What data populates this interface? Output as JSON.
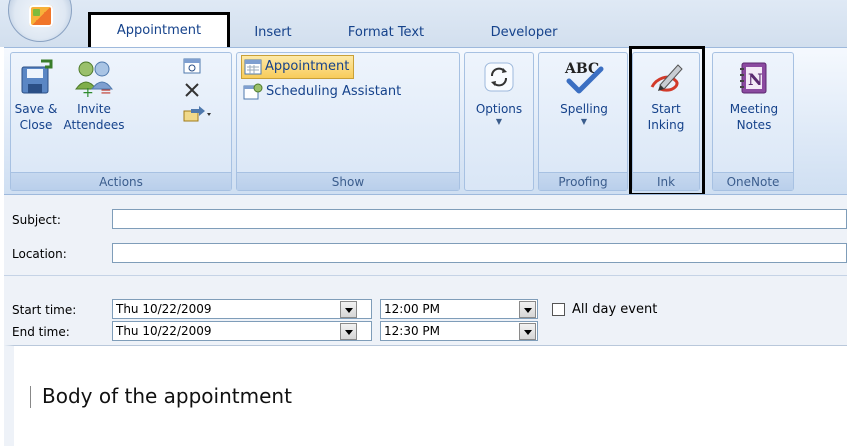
{
  "tabs": [
    "Appointment",
    "Insert",
    "Format Text",
    "Developer"
  ],
  "ribbon": {
    "actions": {
      "label": "Actions",
      "save_close": [
        "Save &",
        "Close"
      ],
      "invite": [
        "Invite",
        "Attendees"
      ]
    },
    "show": {
      "label": "Show",
      "appointment": "Appointment",
      "scheduling": "Scheduling Assistant"
    },
    "options": {
      "label": "Options"
    },
    "proofing": {
      "label": "Proofing",
      "spelling": "Spelling"
    },
    "ink": {
      "label": "Ink",
      "start": [
        "Start",
        "Inking"
      ]
    },
    "onenote": {
      "label": "OneNote",
      "notes": [
        "Meeting",
        "Notes"
      ]
    }
  },
  "form": {
    "subject_label": "Subject:",
    "subject_value": "",
    "location_label": "Location:",
    "location_value": "",
    "start_label": "Start time:",
    "start_date": "Thu 10/22/2009",
    "start_time": "12:00 PM",
    "all_day_label": "All day event",
    "all_day_checked": false,
    "end_label": "End time:",
    "end_date": "Thu 10/22/2009",
    "end_time": "12:30 PM",
    "body": "Body of the appointment"
  }
}
